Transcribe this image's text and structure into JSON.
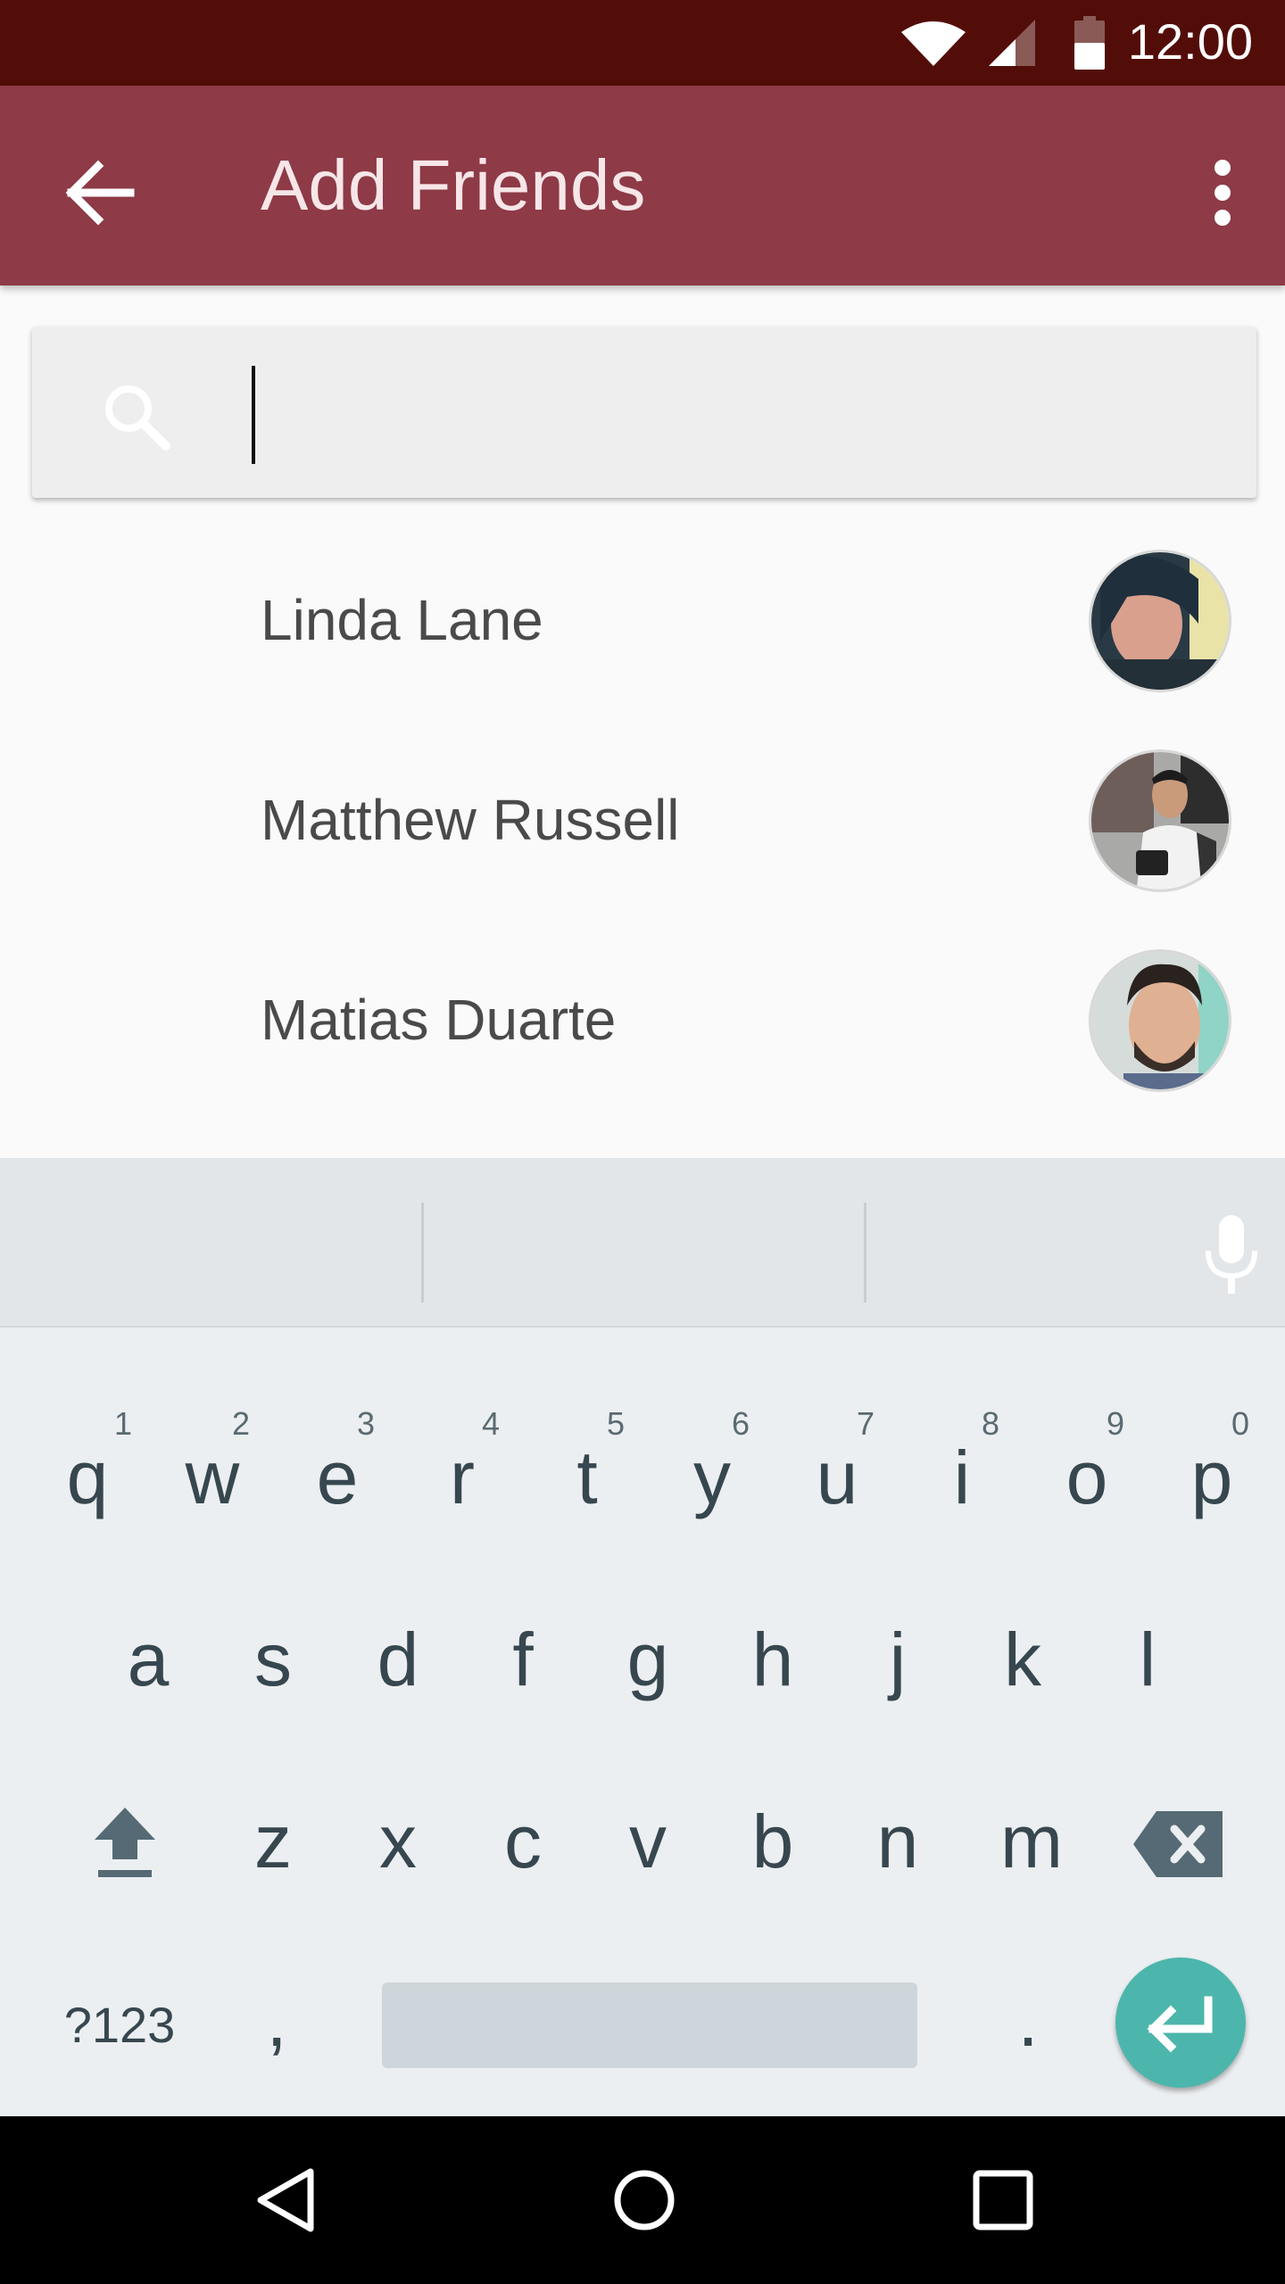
{
  "status_bar": {
    "time": "12:00",
    "icons": [
      "wifi-icon",
      "cell-signal-icon",
      "battery-icon"
    ]
  },
  "app_bar": {
    "title": "Add Friends",
    "back_icon": "arrow-back-icon",
    "menu_icon": "more-vert-icon",
    "color": "#8e3a47"
  },
  "search": {
    "icon": "search-icon",
    "value": "",
    "placeholder": ""
  },
  "contacts": [
    {
      "name": "Linda Lane"
    },
    {
      "name": "Matthew Russell"
    },
    {
      "name": "Matias Duarte"
    }
  ],
  "keyboard": {
    "row1": [
      {
        "key": "q",
        "hint": "1"
      },
      {
        "key": "w",
        "hint": "2"
      },
      {
        "key": "e",
        "hint": "3"
      },
      {
        "key": "r",
        "hint": "4"
      },
      {
        "key": "t",
        "hint": "5"
      },
      {
        "key": "y",
        "hint": "6"
      },
      {
        "key": "u",
        "hint": "7"
      },
      {
        "key": "i",
        "hint": "8"
      },
      {
        "key": "o",
        "hint": "9"
      },
      {
        "key": "p",
        "hint": "0"
      }
    ],
    "row2": [
      "a",
      "s",
      "d",
      "f",
      "g",
      "h",
      "j",
      "k",
      "l"
    ],
    "row3": [
      "z",
      "x",
      "c",
      "v",
      "b",
      "n",
      "m"
    ],
    "symbols_label": "?123",
    "comma_label": ",",
    "period_label": ".",
    "accent_color": "#4db6ac"
  },
  "nav_bar": {
    "icons": [
      "back-triangle-icon",
      "home-circle-icon",
      "recents-square-icon"
    ]
  }
}
